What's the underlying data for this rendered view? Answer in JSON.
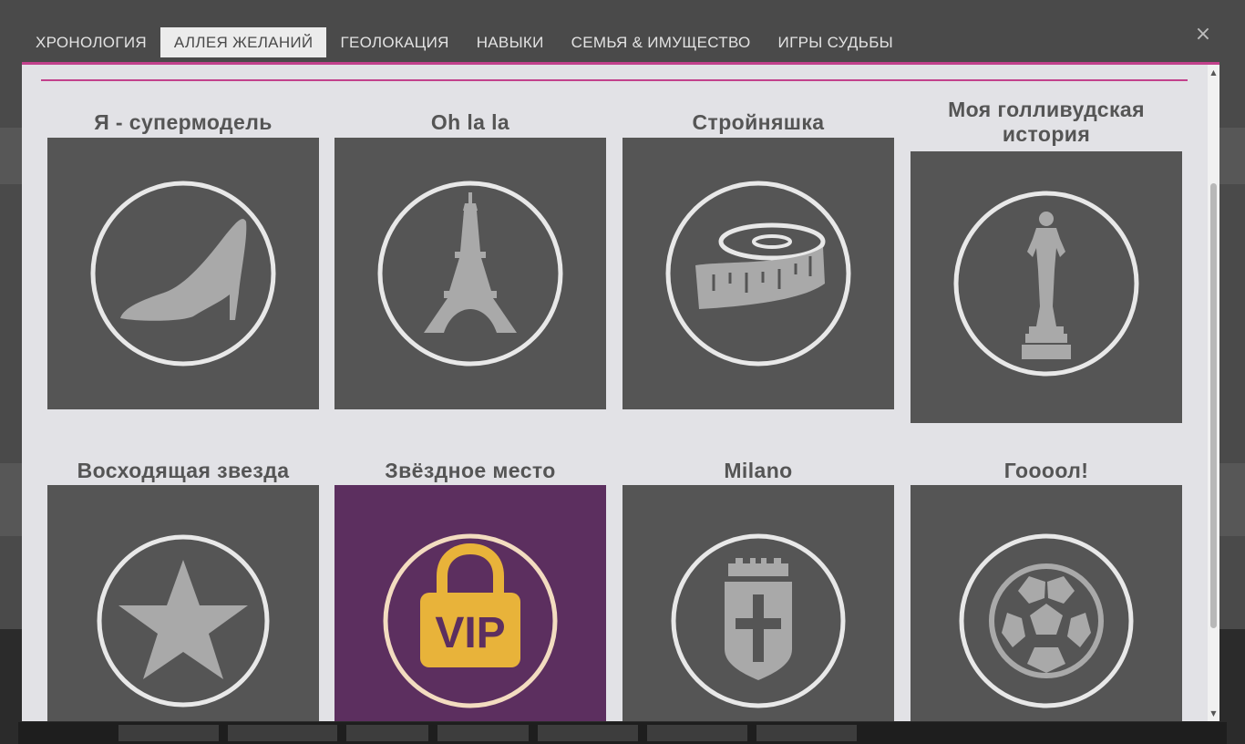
{
  "tabs": [
    {
      "label": "ХРОНОЛОГИЯ",
      "active": false
    },
    {
      "label": "АЛЛЕЯ ЖЕЛАНИЙ",
      "active": true
    },
    {
      "label": "ГЕОЛОКАЦИЯ",
      "active": false
    },
    {
      "label": "НАВЫКИ",
      "active": false
    },
    {
      "label": "СЕМЬЯ & ИМУЩЕСТВО",
      "active": false
    },
    {
      "label": "ИГРЫ СУДЬБЫ",
      "active": false
    }
  ],
  "close_symbol": "×",
  "accent_color": "#c2418c",
  "wishes": [
    {
      "title": "Я - супермодель",
      "icon": "high-heel-icon"
    },
    {
      "title": "Oh la la",
      "icon": "eiffel-tower-icon"
    },
    {
      "title": "Стройняшка",
      "icon": "measuring-tape-icon"
    },
    {
      "title": "Моя голливудская история",
      "icon": "oscar-statuette-icon"
    },
    {
      "title": "Восходящая звезда",
      "icon": "star-icon"
    },
    {
      "title": "Звёздное место",
      "icon": "vip-lock-icon",
      "highlight_color": "#5c2f5f",
      "badge_text": "VIP"
    },
    {
      "title": "Milano",
      "icon": "milan-crest-icon"
    },
    {
      "title": "Гоооол!",
      "icon": "football-icon"
    }
  ]
}
